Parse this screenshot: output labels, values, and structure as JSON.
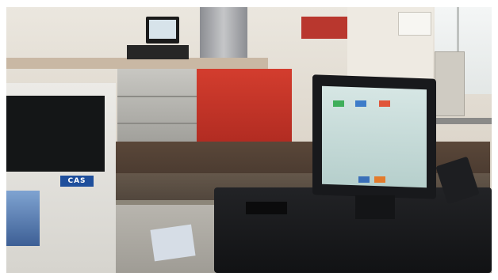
{
  "photo": {
    "subject": "point-of-sale-checkout-counter",
    "scale": {
      "brand_label": "CAS",
      "brand_color": "#1f4f9c"
    },
    "colors": {
      "wall": "#e9e4dc",
      "counter_red": "#c8362a",
      "stainless": "#b9b8b2",
      "terminal_body": "#1b1c1f",
      "screen": "#c4d9d8",
      "floor": "#4a3a2f"
    },
    "touchscreen_keys": [
      {
        "color": "#3fae5a"
      },
      {
        "color": "#e0553a"
      },
      {
        "color": "#3d7cc9"
      },
      {
        "color": "#e37b2c"
      },
      {
        "color": "#3a6fb8"
      }
    ]
  }
}
